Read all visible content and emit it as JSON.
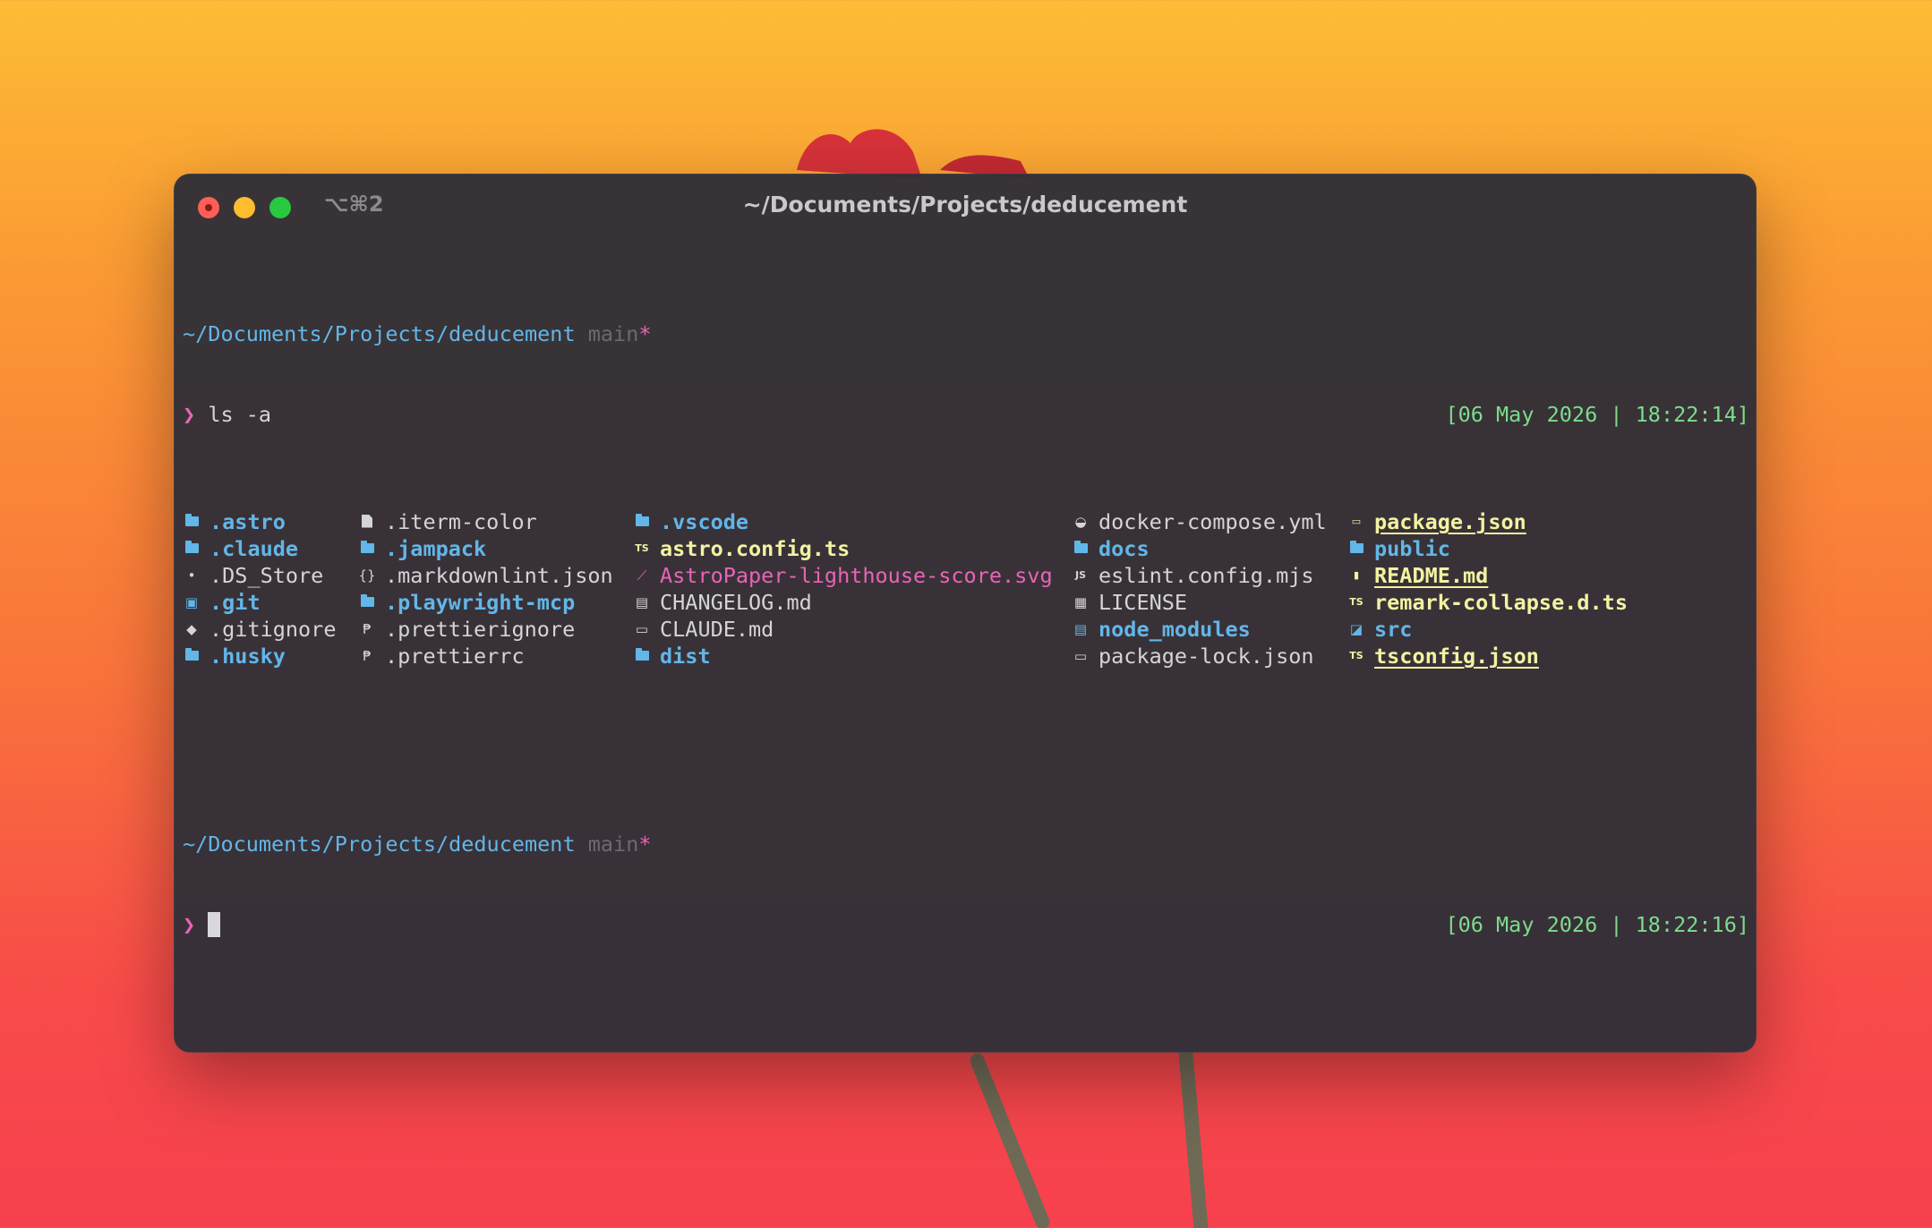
{
  "window": {
    "shortcut": "⌥⌘2",
    "title": "~/Documents/Projects/deducement"
  },
  "prompt1": {
    "path": "~/Documents/Projects/deducement",
    "branch": "main",
    "dirty_marker": "*",
    "arrow": "❯",
    "command": "ls -a",
    "timestamp": "[06 May 2026 | 18:22:14]"
  },
  "listing": {
    "col1": [
      {
        "name": ".astro",
        "icon": "folder-icon"
      },
      {
        "name": ".claude",
        "icon": "folder-icon"
      },
      {
        "name": ".DS_Store",
        "icon": "apple-icon"
      },
      {
        "name": ".git",
        "icon": "git-folder-icon"
      },
      {
        "name": ".gitignore",
        "icon": "git-icon"
      },
      {
        "name": ".husky",
        "icon": "folder-icon"
      }
    ],
    "col2": [
      {
        "name": ".iterm-color",
        "icon": "file-icon"
      },
      {
        "name": ".jampack",
        "icon": "folder-icon"
      },
      {
        "name": ".markdownlint.json",
        "icon": "json-icon"
      },
      {
        "name": ".playwright-mcp",
        "icon": "folder-icon"
      },
      {
        "name": ".prettierignore",
        "icon": "prettier-icon"
      },
      {
        "name": ".prettierrc",
        "icon": "prettier-icon"
      }
    ],
    "col3": [
      {
        "name": ".vscode",
        "icon": "folder-icon"
      },
      {
        "name": "astro.config.ts",
        "icon": "typescript-icon",
        "icon_text": "TS"
      },
      {
        "name": "AstroPaper-lighthouse-score.svg",
        "icon": "svg-icon"
      },
      {
        "name": "CHANGELOG.md",
        "icon": "changelog-icon"
      },
      {
        "name": "CLAUDE.md",
        "icon": "markdown-icon"
      },
      {
        "name": "dist",
        "icon": "folder-icon"
      }
    ],
    "col4": [
      {
        "name": "docker-compose.yml",
        "icon": "docker-icon"
      },
      {
        "name": "docs",
        "icon": "folder-icon"
      },
      {
        "name": "eslint.config.mjs",
        "icon": "javascript-icon",
        "icon_text": "JS"
      },
      {
        "name": "LICENSE",
        "icon": "license-icon"
      },
      {
        "name": "node_modules",
        "icon": "node-folder-icon"
      },
      {
        "name": "package-lock.json",
        "icon": "npm-icon"
      }
    ],
    "col5": [
      {
        "name": "package.json",
        "icon": "npm-icon"
      },
      {
        "name": "public",
        "icon": "folder-icon"
      },
      {
        "name": "README.md",
        "icon": "readme-icon"
      },
      {
        "name": "remark-collapse.d.ts",
        "icon": "typescript-icon",
        "icon_text": "TS"
      },
      {
        "name": "src",
        "icon": "src-folder-icon"
      },
      {
        "name": "tsconfig.json",
        "icon": "typescript-icon",
        "icon_text": "TS"
      }
    ]
  },
  "prompt2": {
    "path": "~/Documents/Projects/deducement",
    "branch": "main",
    "dirty_marker": "*",
    "arrow": "❯",
    "timestamp": "[06 May 2026 | 18:22:16]"
  },
  "colors": {
    "directory": "#62b6e8",
    "typescript": "#f3f2a2",
    "svg": "#e964b6",
    "timestamp": "#7ddc8c",
    "prompt_arrow": "#e964b6"
  }
}
